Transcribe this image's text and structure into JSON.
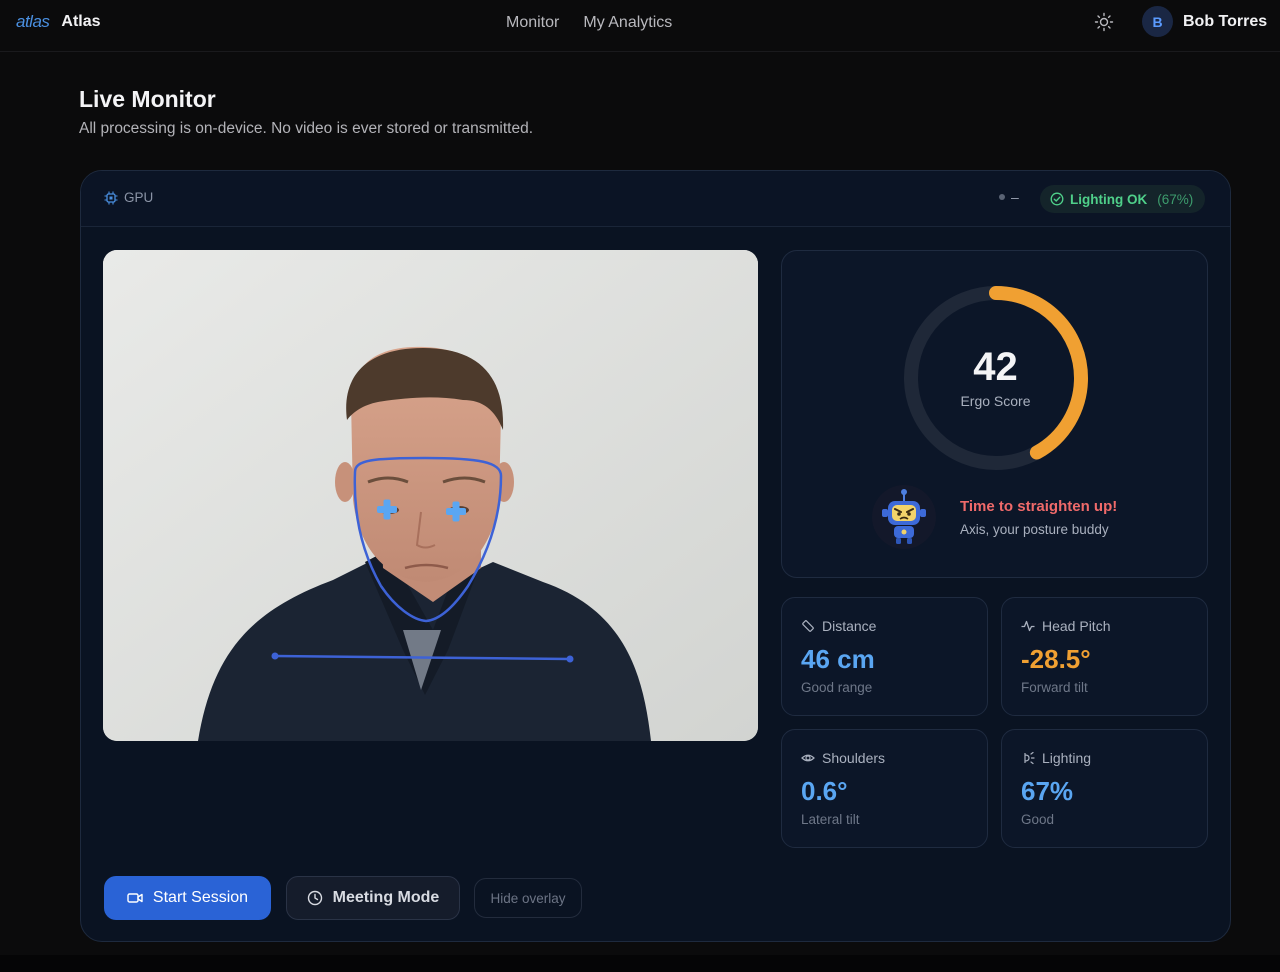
{
  "topbar": {
    "logo": "atlas",
    "app_name": "Atlas",
    "nav": [
      "Monitor",
      "My Analytics"
    ],
    "theme_icon": "sun-icon",
    "user": {
      "initial": "B",
      "name": "Bob Torres"
    }
  },
  "page": {
    "title": "Live Monitor",
    "subtitle": "All processing is on-device. No video is ever stored or transmitted."
  },
  "panel": {
    "backend": "GPU",
    "status_dash": "–",
    "lighting_badge": {
      "label": "Lighting OK",
      "pct": "(67%)"
    }
  },
  "score": {
    "value": "42",
    "label": "Ergo Score",
    "progress": 0.42,
    "ring_color": "#f0a032",
    "buddy_message": "Time to straighten up!",
    "buddy_sub": "Axis, your posture buddy"
  },
  "metrics": {
    "distance": {
      "label": "Distance",
      "value": "46 cm",
      "sub": "Good range"
    },
    "head_pitch": {
      "label": "Head Pitch",
      "value": "-28.5°",
      "sub": "Forward tilt"
    },
    "shoulders": {
      "label": "Shoulders",
      "value": "0.6°",
      "sub": "Lateral tilt"
    },
    "lighting": {
      "label": "Lighting",
      "value": "67%",
      "sub": "Good"
    }
  },
  "actions": {
    "start": "Start Session",
    "meeting": "Meeting Mode",
    "hide_overlay": "Hide overlay"
  }
}
